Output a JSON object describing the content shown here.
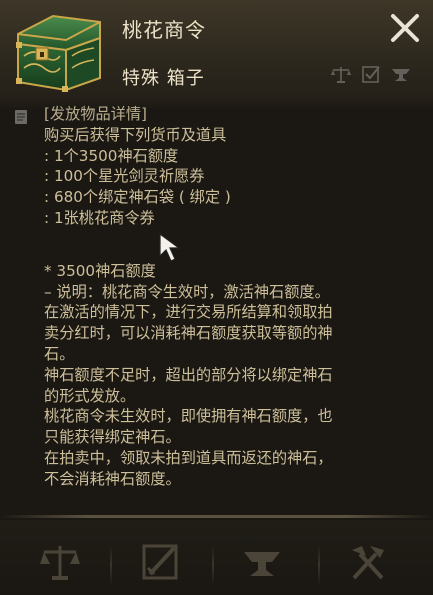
{
  "item": {
    "title": "桃花商令",
    "subtitle": "特殊 箱子"
  },
  "description": {
    "section_header": "[发放物品详情]",
    "intro": "购买后获得下列货币及道具",
    "rewards": [
      ":  1个3500神石额度",
      ":  100个星光剑灵祈愿券",
      ":  680个绑定神石袋 ( 绑定 )",
      ":  1张桃花商令券"
    ],
    "notes": [
      "* 3500神石额度",
      "– 说明：桃花商令生效时，激活神石额度。",
      "在激活的情况下，进行交易所结算和领取拍",
      "卖分红时，可以消耗神石额度获取等额的神",
      "石。",
      "神石额度不足时，超出的部分将以绑定神石",
      "的形式发放。",
      "桃花商令未生效时，即使拥有神石额度，也",
      "只能获得绑定神石。",
      "在拍卖中，领取未拍到道具而返还的神石，",
      "不会消耗神石额度。"
    ]
  },
  "icons": {
    "item": "treasure-chest-icon",
    "close": "close-icon",
    "header_actions": [
      "scale-icon",
      "check-box-icon",
      "anvil-icon"
    ],
    "scroll": "scroll-icon",
    "bottom_actions": [
      "scale-icon",
      "sword-check-icon",
      "anvil-icon",
      "hammer-pick-icon"
    ]
  },
  "colors": {
    "background": "#1b1813",
    "text": "#cdbf9a",
    "title": "#ece2c8",
    "chest_green": "#2f6a36",
    "chest_gold": "#c9a64a"
  }
}
